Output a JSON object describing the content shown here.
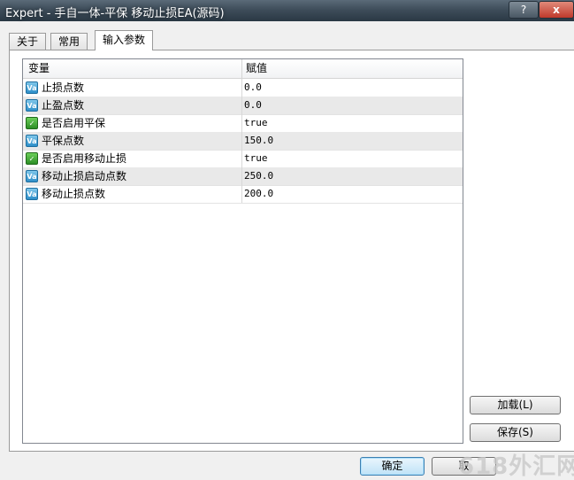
{
  "window": {
    "title": "Expert - 手自一体-平保 移动止损EA(源码)"
  },
  "titlebar": {
    "help_label": "?",
    "close_label": "x"
  },
  "tabs": [
    {
      "label": "关于"
    },
    {
      "label": "常用"
    },
    {
      "label": "输入参数",
      "active": true
    }
  ],
  "grid": {
    "columns": {
      "variable": "变量",
      "value": "赋值"
    },
    "rows": [
      {
        "icon": "numeric-param-icon",
        "name": "止损点数",
        "value": "0.0"
      },
      {
        "icon": "numeric-param-icon",
        "name": "止盈点数",
        "value": "0.0"
      },
      {
        "icon": "boolean-param-icon",
        "name": "是否启用平保",
        "value": "true"
      },
      {
        "icon": "numeric-param-icon",
        "name": "平保点数",
        "value": "150.0"
      },
      {
        "icon": "boolean-param-icon",
        "name": "是否启用移动止损",
        "value": "true"
      },
      {
        "icon": "numeric-param-icon",
        "name": "移动止损启动点数",
        "value": "250.0"
      },
      {
        "icon": "numeric-param-icon",
        "name": "移动止损点数",
        "value": "200.0"
      }
    ]
  },
  "buttons": {
    "load": "加载(L)",
    "save": "保存(S)",
    "ok": "确定",
    "cancel": "取"
  },
  "watermark": "618外汇网",
  "colors": {
    "title_bar": "#3e4d5a",
    "alt_row": "#e9e9e9",
    "numeric_icon": "#2e8fc9",
    "boolean_icon": "#2c8e25"
  }
}
